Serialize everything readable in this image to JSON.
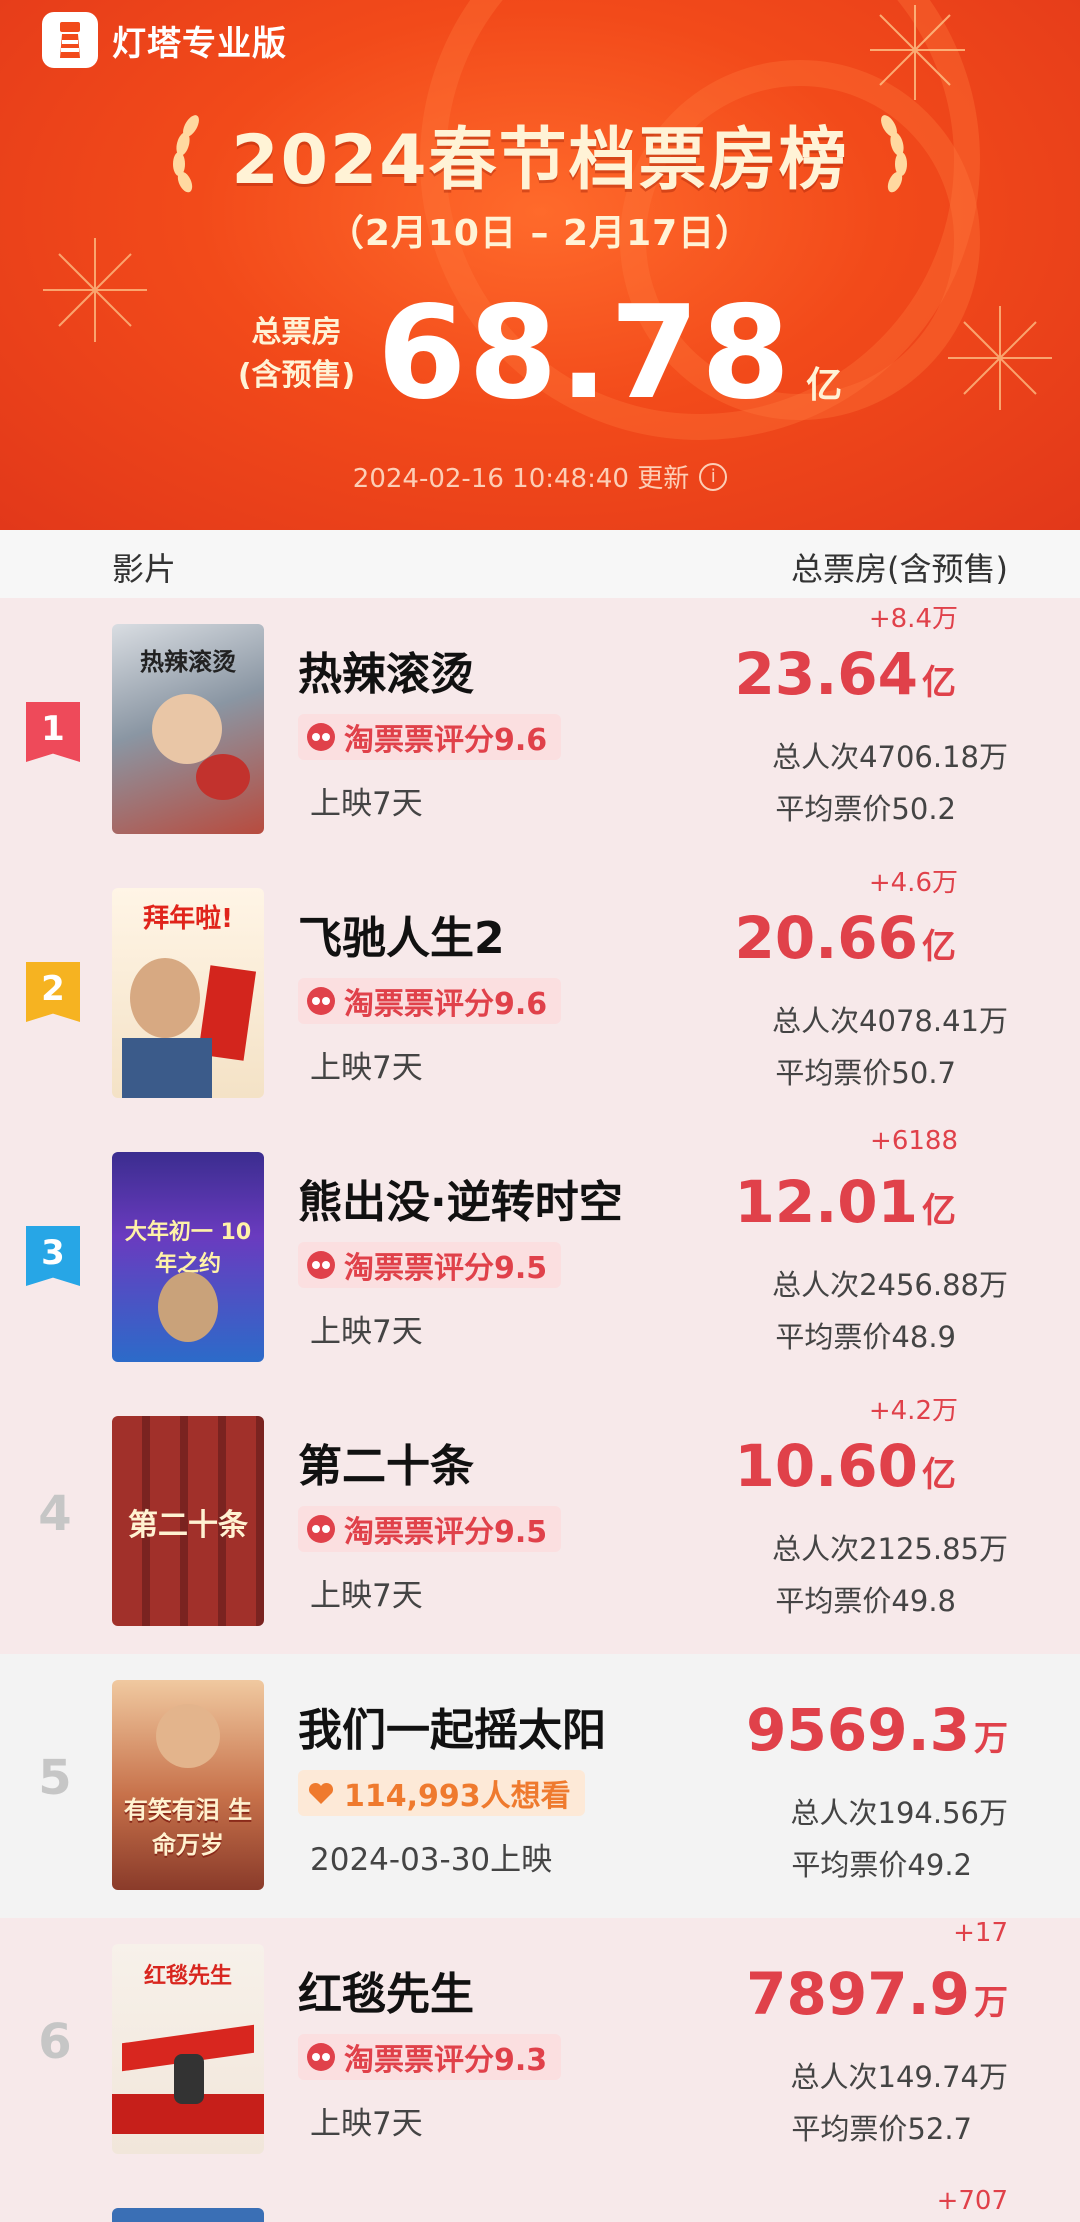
{
  "brand": {
    "name": "灯塔专业版",
    "logo_icon": "lighthouse-icon"
  },
  "header": {
    "title": "2024春节档票房榜",
    "date_range": "（2月10日 – 2月17日）",
    "total_label_line1": "总票房",
    "total_label_line2": "(含预售)",
    "total_value": "68.78",
    "total_unit": "亿",
    "updated": "2024-02-16 10:48:40 更新",
    "info_icon": "info-icon"
  },
  "columns": {
    "film": "影片",
    "gross": "总票房(含预售)"
  },
  "colors": {
    "accent": "#e0414a",
    "rank1": "#ee4a5a",
    "rank2": "#f6b321",
    "rank3": "#27a6e6",
    "header": "#f24a1a"
  },
  "films": [
    {
      "rank": "1",
      "title": "热辣滚烫",
      "score_label": "淘票票评分9.6",
      "release": "上映7天",
      "delta": "+8.4万",
      "gross_num": "23.64",
      "gross_unit": "亿",
      "viewers": "总人次4706.18万",
      "avg_price": "平均票价50.2",
      "poster_text": "热辣滚烫"
    },
    {
      "rank": "2",
      "title": "飞驰人生2",
      "score_label": "淘票票评分9.6",
      "release": "上映7天",
      "delta": "+4.6万",
      "gross_num": "20.66",
      "gross_unit": "亿",
      "viewers": "总人次4078.41万",
      "avg_price": "平均票价50.7",
      "poster_text": "拜年啦!"
    },
    {
      "rank": "3",
      "title": "熊出没·逆转时空",
      "score_label": "淘票票评分9.5",
      "release": "上映7天",
      "delta": "+6188",
      "gross_num": "12.01",
      "gross_unit": "亿",
      "viewers": "总人次2456.88万",
      "avg_price": "平均票价48.9",
      "poster_text": "大年初一 10年之约"
    },
    {
      "rank": "4",
      "title": "第二十条",
      "score_label": "淘票票评分9.5",
      "release": "上映7天",
      "delta": "+4.2万",
      "gross_num": "10.60",
      "gross_unit": "亿",
      "viewers": "总人次2125.85万",
      "avg_price": "平均票价49.8",
      "poster_text": "第二十条"
    },
    {
      "rank": "5",
      "title": "我们一起摇太阳",
      "score_label": "114,993人想看",
      "release": "2024-03-30上映",
      "delta": "",
      "gross_num": "9569.3",
      "gross_unit": "万",
      "viewers": "总人次194.56万",
      "avg_price": "平均票价49.2",
      "poster_text": "有笑有泪 生命万岁"
    },
    {
      "rank": "6",
      "title": "红毯先生",
      "score_label": "淘票票评分9.3",
      "release": "上映7天",
      "delta": "+17",
      "gross_num": "7897.9",
      "gross_unit": "万",
      "viewers": "总人次149.74万",
      "avg_price": "平均票价52.7",
      "poster_text": "红毯先生"
    },
    {
      "delta": "+707"
    }
  ]
}
